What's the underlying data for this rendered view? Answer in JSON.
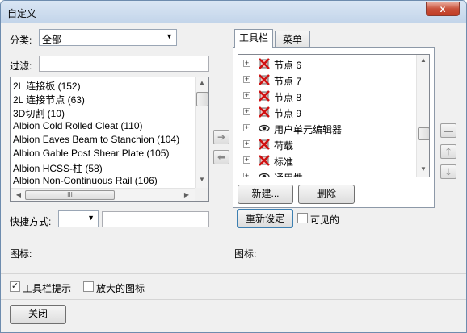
{
  "window": {
    "title": "自定义",
    "close_glyph": "x"
  },
  "category": {
    "label": "分类:",
    "value": "全部"
  },
  "filter": {
    "label": "过滤:",
    "value": ""
  },
  "commands": {
    "items": [
      "2L 连接板 (152)",
      "2L 连接节点 (63)",
      "3D切割 (10)",
      "Albion Cold Rolled Cleat (110)",
      "Albion Eaves Beam to Stanchion (104)",
      "Albion Gable Post Shear Plate (105)",
      "Albion HCSS-柱 (58)",
      "Albion Non-Continuous Rail (106)"
    ],
    "hscroll_grip": "III"
  },
  "move_arrows": {
    "right": "➔",
    "left": "⬅"
  },
  "shortcut": {
    "label": "快捷方式:",
    "value": "",
    "text": ""
  },
  "icon_label_left": "图标:",
  "tabs": [
    {
      "label": "工具栏"
    },
    {
      "label": "菜单"
    }
  ],
  "toolbar_tree": {
    "items": [
      {
        "label": "节点 6",
        "icon": "x-icon"
      },
      {
        "label": "节点 7",
        "icon": "x-icon"
      },
      {
        "label": "节点 8",
        "icon": "x-icon"
      },
      {
        "label": "节点 9",
        "icon": "x-icon"
      },
      {
        "label": "用户单元编辑器",
        "icon": "eye-icon"
      },
      {
        "label": "荷载",
        "icon": "x-icon"
      },
      {
        "label": "标准",
        "icon": "x-icon"
      },
      {
        "label": "通用性",
        "icon": "eye-icon"
      }
    ]
  },
  "tree_buttons": {
    "new": "新建...",
    "delete": "删除",
    "rename": "重新设定",
    "visible": "可见的",
    "visible_checked": false
  },
  "side_buttons": {
    "remove": "—",
    "up": "🡑",
    "down": "🡓"
  },
  "icon_label_right": "图标:",
  "options": {
    "toolbar_tips": "工具栏提示",
    "toolbar_tips_checked": true,
    "large_icons": "放大的图标",
    "large_icons_checked": false
  },
  "footer": {
    "close": "关闭"
  }
}
